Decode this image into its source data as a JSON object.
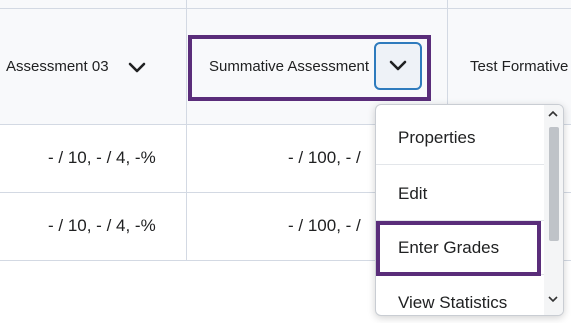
{
  "columns": [
    {
      "title": "Assessment 03"
    },
    {
      "title": "Summative Assessment"
    },
    {
      "title": "Test Formative"
    }
  ],
  "rows": [
    {
      "cells": [
        "- / 10, - / 4, -%",
        "- / 100, - /"
      ]
    },
    {
      "cells": [
        "- / 10, - / 4, -%",
        "- / 100, - /"
      ]
    }
  ],
  "menu": {
    "items": [
      {
        "label": "Properties"
      },
      {
        "label": "Edit"
      },
      {
        "label": "Enter Grades"
      },
      {
        "label": "View Statistics"
      }
    ]
  },
  "colors": {
    "highlight": "#5a2d7a",
    "focus": "#2e7bbd"
  }
}
